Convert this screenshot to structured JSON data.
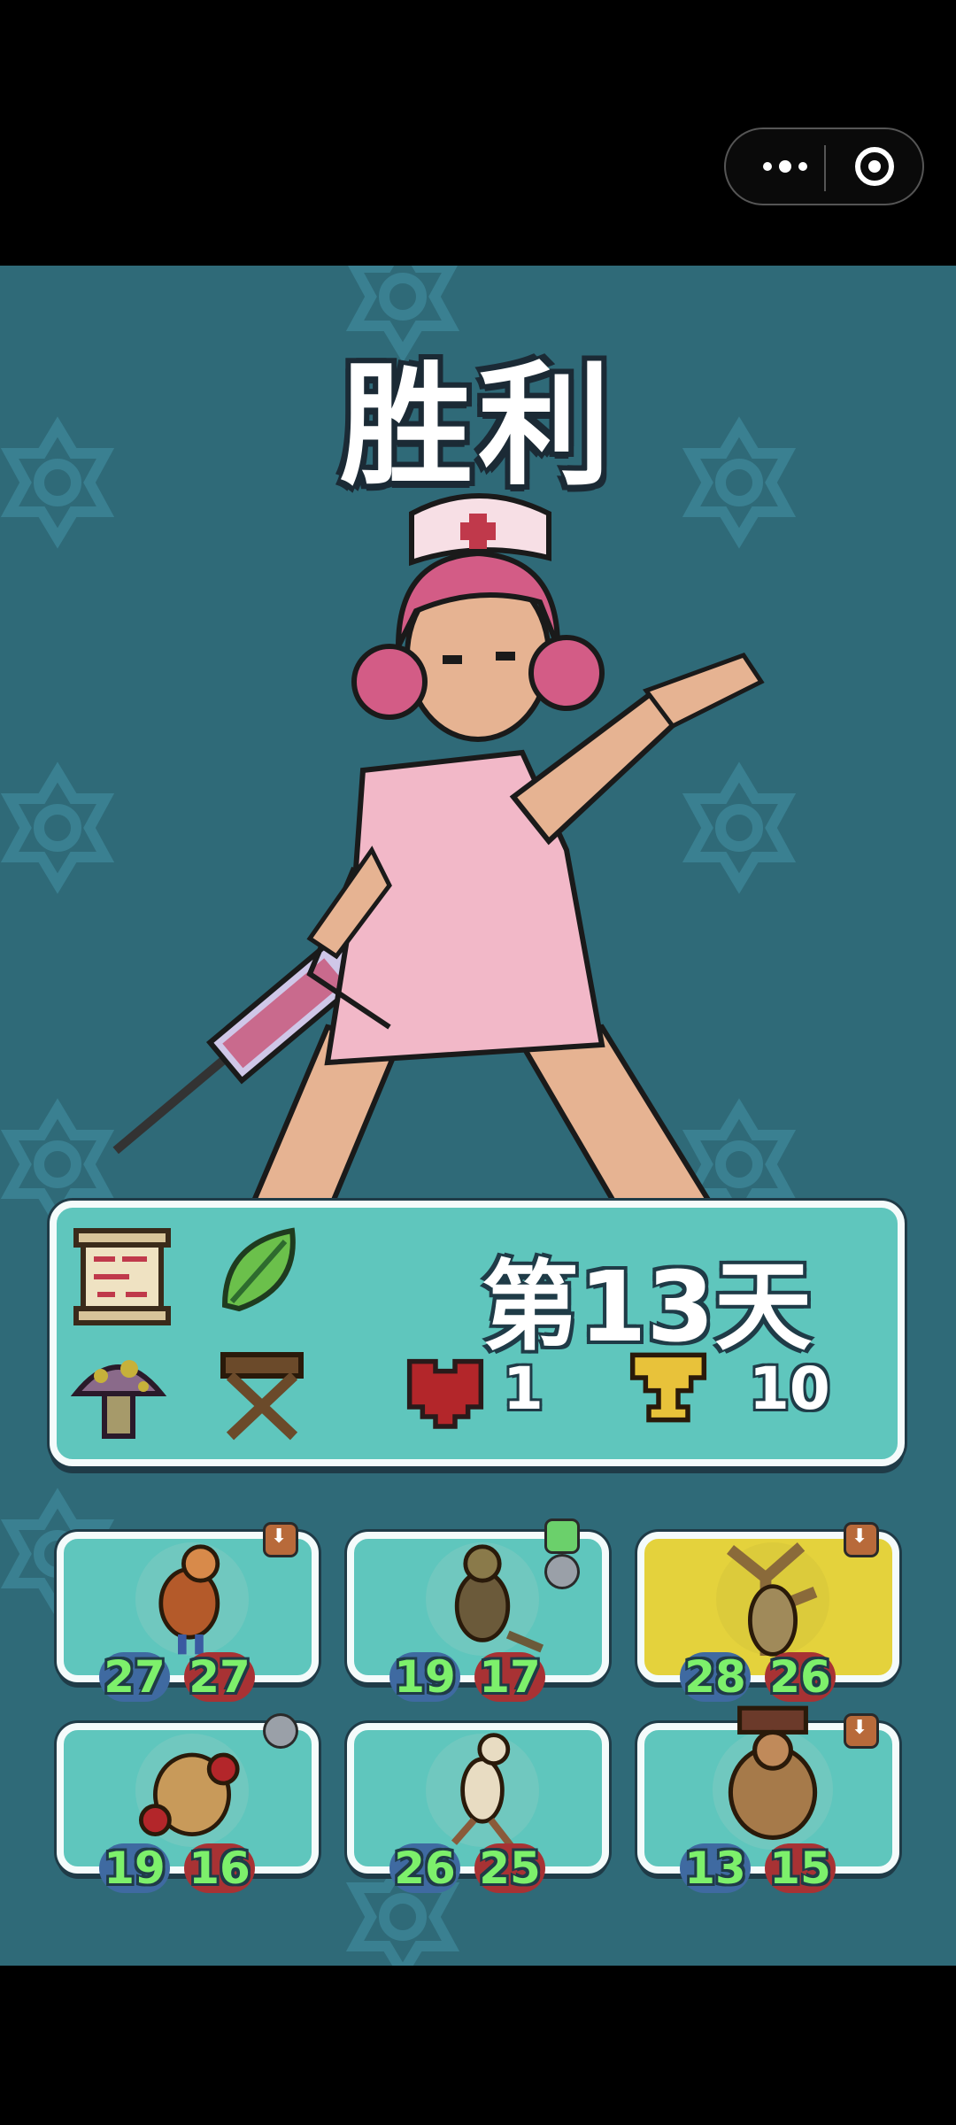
{
  "title": "胜利",
  "day_label": "第13天",
  "lives": "1",
  "trophies": "10",
  "colors": {
    "background": "#2f6a78",
    "panel": "#5fc6bd",
    "selected": "#e4d23c",
    "attack": "#3f6aa1",
    "health": "#a83234"
  },
  "items": [
    {
      "icon": "scroll-icon"
    },
    {
      "icon": "leaf-icon"
    },
    {
      "icon": "mushroom-icon"
    },
    {
      "icon": "stool-icon"
    }
  ],
  "team": [
    {
      "name": "rooster-fighter",
      "attack": "27",
      "health": "27",
      "badge": "down",
      "selected": false
    },
    {
      "name": "lizard-warrior",
      "attack": "19",
      "health": "17",
      "badge": "green-skull",
      "selected": false
    },
    {
      "name": "tree-creature",
      "attack": "28",
      "health": "26",
      "badge": "down",
      "selected": true
    },
    {
      "name": "potato-creature",
      "attack": "19",
      "health": "16",
      "badge": "skull",
      "selected": false
    },
    {
      "name": "bird-dancer",
      "attack": "26",
      "health": "25",
      "badge": "none",
      "selected": false
    },
    {
      "name": "ogre-brute",
      "attack": "13",
      "health": "15",
      "badge": "down",
      "selected": false
    }
  ]
}
